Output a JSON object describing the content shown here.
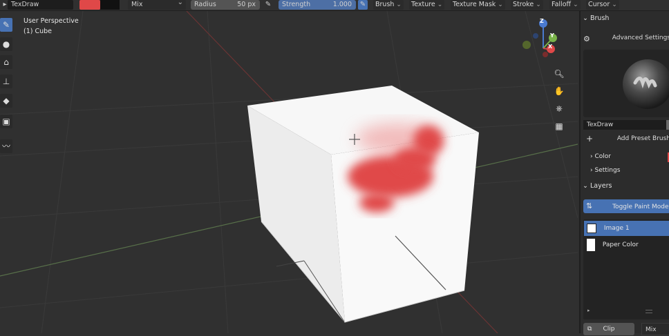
{
  "header": {
    "brush_name": "TexDraw",
    "color_swatch": "#e04848",
    "blend_mode": "Mix",
    "radius_label": "Radius",
    "radius_value": "50 px",
    "strength_label": "Strength",
    "strength_value": "1.000",
    "menus": [
      "Brush",
      "Texture",
      "Texture Mask",
      "Stroke",
      "Falloff",
      "Cursor"
    ]
  },
  "viewport": {
    "view_name": "User Perspective",
    "object_name": "(1) Cube",
    "gizmo_axes": [
      "Z",
      "Y",
      "X"
    ],
    "paint_color": "#e04848"
  },
  "left_tools": [
    "draw-brush",
    "soften-brush",
    "smear-brush",
    "clone-brush",
    "fill-brush",
    "mask-brush",
    "annotate-tool"
  ],
  "nav_icons": [
    "zoom-icon",
    "hand-icon",
    "camera-icon",
    "perspective-grid-icon"
  ],
  "panel": {
    "brush_section": "Brush",
    "advanced_settings": "Advanced Settings",
    "brush_preview_name": "TexDraw",
    "add_preset": "Add Preset Brush",
    "color_row": "Color",
    "settings_row": "Settings",
    "layers_section": "Layers",
    "toggle_paint_mode": "Toggle Paint Mode",
    "layers": [
      {
        "name": "Image 1",
        "selected": true
      },
      {
        "name": "Paper Color",
        "selected": false
      }
    ],
    "clip_button": "Clip",
    "blend_select": "Mix"
  }
}
